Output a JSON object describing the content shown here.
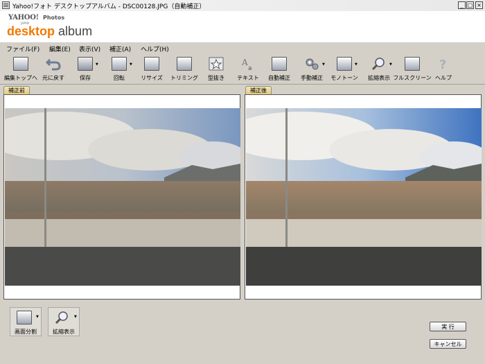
{
  "window": {
    "title": "Yahoo!フォト デスクトップアルバム - DSC00128.JPG（自動補正）",
    "min_label": "_",
    "max_label": "□",
    "close_label": "×"
  },
  "brand": {
    "yahoo": "YAHOO!",
    "japan": "JAPAN",
    "photos": "Photos",
    "desktop": "desktop",
    "album": "album"
  },
  "menu": [
    {
      "label": "ファイル(F)"
    },
    {
      "label": "編集(E)"
    },
    {
      "label": "表示(V)"
    },
    {
      "label": "補正(A)"
    },
    {
      "label": "ヘルプ(H)"
    }
  ],
  "toolbar": {
    "back_to_top": "編集トップへ",
    "undo": "元に戻す",
    "save": "保存",
    "rotate": "回転",
    "resize": "リサイズ",
    "trimming": "トリミング",
    "cutout": "型抜き",
    "text": "テキスト",
    "auto_correct": "自動補正",
    "manual_correct": "手動補正",
    "monotone": "モノトーン",
    "zoom": "拡縮表示",
    "fullscreen": "フルスクリーン",
    "help": "ヘルプ"
  },
  "panels": {
    "before": "補正前",
    "after": "補正後"
  },
  "bottom": {
    "split_screen": "画面分割",
    "zoom": "拡縮表示",
    "execute": "実 行",
    "cancel": "キャンセル"
  }
}
